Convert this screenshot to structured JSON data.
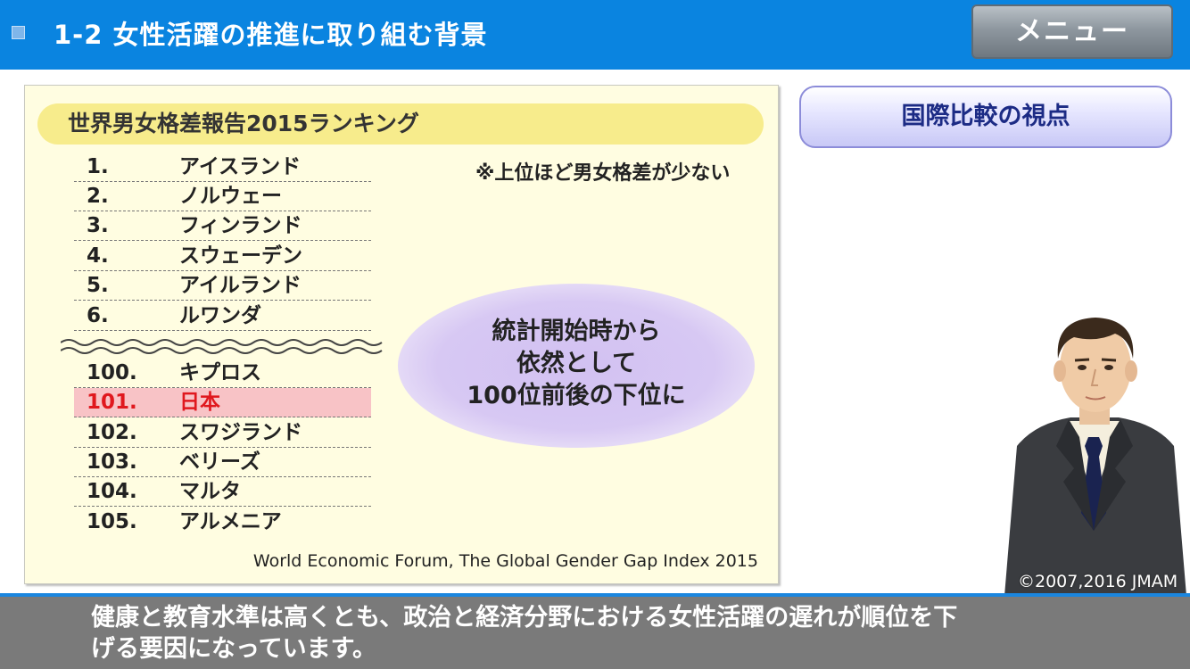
{
  "header": {
    "title": "1-2 女性活躍の推進に取り組む背景",
    "menu_label": "メニュー"
  },
  "panel": {
    "title": "世界男女格差報告2015ランキング",
    "note": "※上位ほど男女格差が少ない",
    "ranking_top": [
      {
        "rank": "1.",
        "country": "アイスランド"
      },
      {
        "rank": "2.",
        "country": "ノルウェー"
      },
      {
        "rank": "3.",
        "country": "フィンランド"
      },
      {
        "rank": "4.",
        "country": "スウェーデン"
      },
      {
        "rank": "5.",
        "country": "アイルランド"
      },
      {
        "rank": "6.",
        "country": "ルワンダ"
      }
    ],
    "ranking_bottom": [
      {
        "rank": "100.",
        "country": "キプロス"
      },
      {
        "rank": "101.",
        "country": "日本"
      },
      {
        "rank": "102.",
        "country": "スワジランド"
      },
      {
        "rank": "103.",
        "country": "ベリーズ"
      },
      {
        "rank": "104.",
        "country": "マルタ"
      },
      {
        "rank": "105.",
        "country": "アルメニア"
      }
    ],
    "callout_lines": [
      "統計開始時から",
      "依然として",
      "100位前後の下位に"
    ],
    "source": "World Economic Forum, The Global Gender Gap Index 2015"
  },
  "side": {
    "button_label": "国際比較の視点",
    "copyright": "©2007,2016 JMAM"
  },
  "subtitle": {
    "line1": "健康と教育水準は高くとも、政治と経済分野における女性活躍の遅れが順位を下",
    "line2": "げる要因になっています。"
  },
  "colors": {
    "header_blue": "#0a84e0",
    "panel_bg": "#fffde1",
    "highlight_red": "#e0181e",
    "highlight_bg": "#f8c3c6"
  }
}
